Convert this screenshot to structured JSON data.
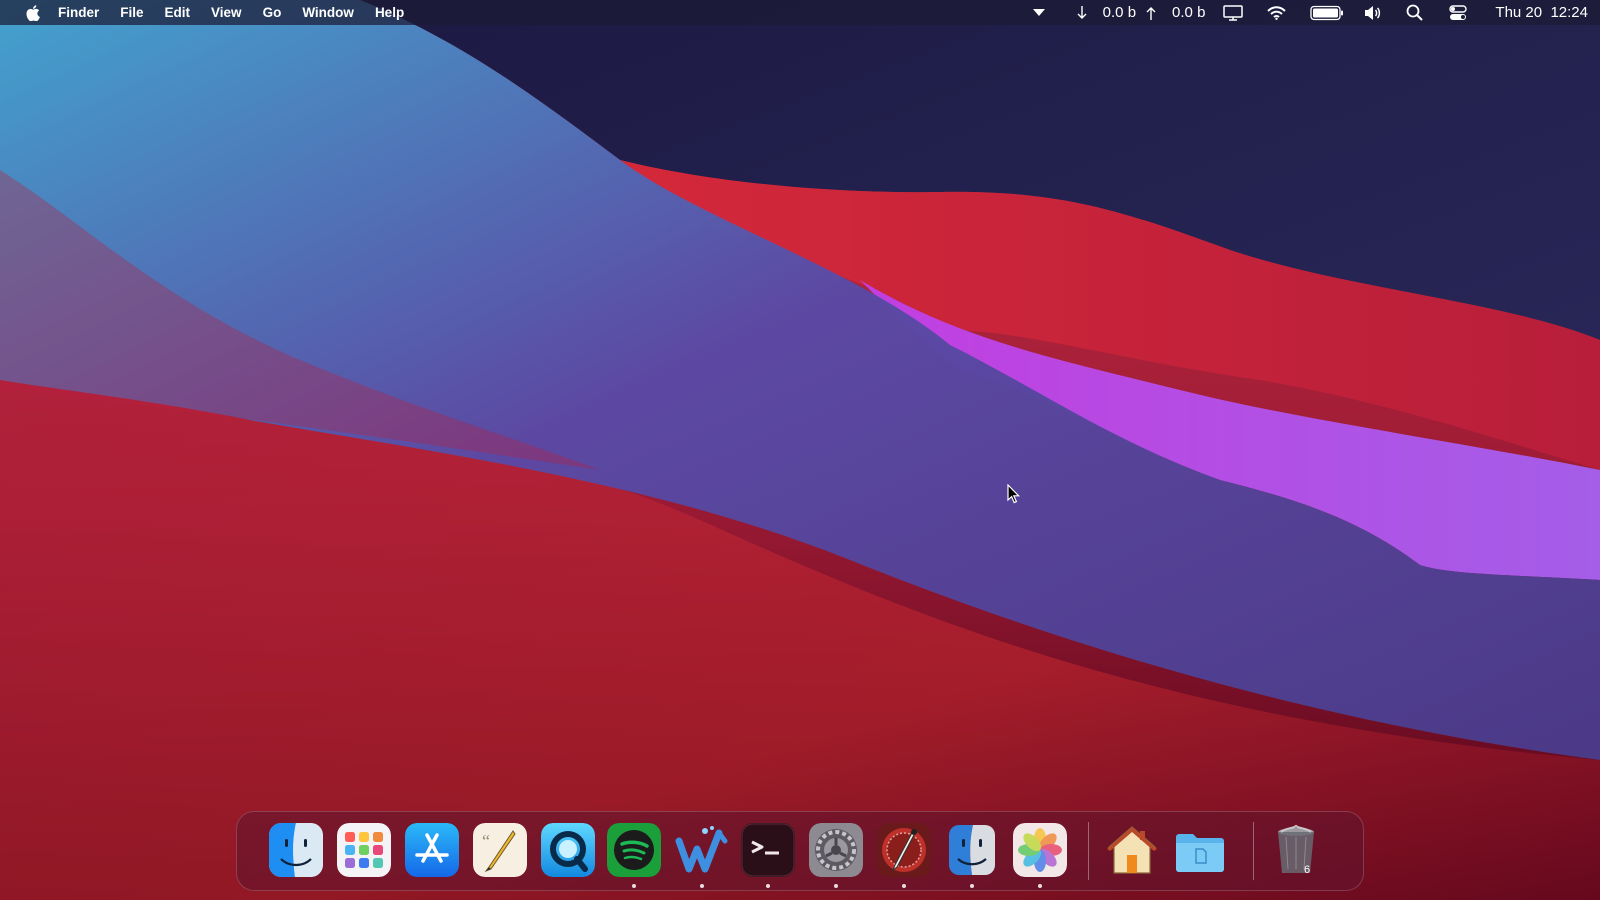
{
  "menubar": {
    "apple_icon": "apple-logo-icon",
    "menus": [
      {
        "label": "Finder"
      },
      {
        "label": "File"
      },
      {
        "label": "Edit"
      },
      {
        "label": "View"
      },
      {
        "label": "Go"
      },
      {
        "label": "Window"
      },
      {
        "label": "Help"
      }
    ],
    "status": {
      "download_rate": "0.0 b",
      "upload_rate": "0.0 b",
      "clock": "Thu 20  12:24"
    }
  },
  "dock": {
    "apps": [
      {
        "name": "Finder",
        "icon": "finder-icon",
        "running": false
      },
      {
        "name": "Launchpad",
        "icon": "launchpad-icon",
        "running": false
      },
      {
        "name": "App Store",
        "icon": "app-store-icon",
        "running": false
      },
      {
        "name": "Script Editor",
        "icon": "script-editor-icon",
        "running": false
      },
      {
        "name": "QuickTime Player",
        "icon": "quicktime-icon",
        "running": false
      },
      {
        "name": "Spotify",
        "icon": "spotify-icon",
        "running": true
      },
      {
        "name": "Wally",
        "icon": "wally-icon",
        "running": true
      },
      {
        "name": "Terminal",
        "icon": "terminal-icon",
        "running": true
      },
      {
        "name": "System Preferences",
        "icon": "system-preferences-icon",
        "running": true
      },
      {
        "name": "Digital Color Meter",
        "icon": "color-meter-icon",
        "running": true
      },
      {
        "name": "Finder",
        "icon": "finder-alt-icon",
        "running": true
      },
      {
        "name": "Photos",
        "icon": "photos-icon",
        "running": true
      }
    ],
    "folders": [
      {
        "name": "Home",
        "icon": "home-folder-icon"
      },
      {
        "name": "Documents",
        "icon": "documents-folder-icon"
      }
    ],
    "trash": {
      "name": "Trash",
      "icon": "trash-icon",
      "badge": "6"
    }
  },
  "colors": {
    "menubar_bg": "#1c1a34",
    "wallpaper_red": "#c0253a",
    "wallpaper_blue": "#2fa0cc",
    "wallpaper_purple": "#9a4fd8",
    "wallpaper_navy": "#221f4c"
  }
}
